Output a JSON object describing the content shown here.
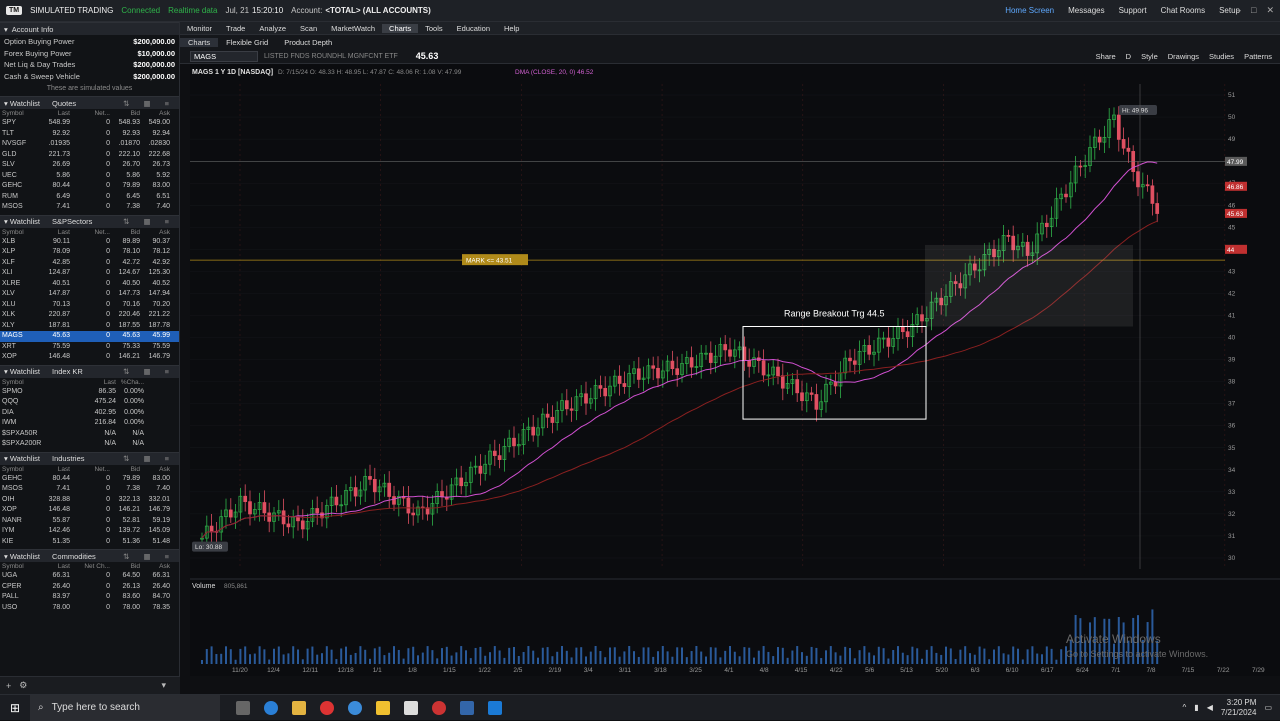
{
  "titlebar": {
    "badge": "TM",
    "app_name": "SIMULATED TRADING",
    "status": "Connected",
    "data_mode": "Realtime data",
    "date": "Jul, 21",
    "time": "15:20:10",
    "account_label": "Account:",
    "account": "<TOTAL> (ALL ACCOUNTS)",
    "home": "Home Screen",
    "messages": "Messages",
    "support": "Support",
    "chat": "Chat Rooms",
    "setup": "Setup"
  },
  "account_info": {
    "title": "Account Info",
    "rows": [
      {
        "label": "Option Buying Power",
        "value": "$200,000.00"
      },
      {
        "label": "Forex Buying Power",
        "value": "$10,000.00"
      },
      {
        "label": "Net Liq & Day Trades",
        "value": "$200,000.00"
      },
      {
        "label": "Cash & Sweep Vehicle",
        "value": "$200,000.00"
      }
    ],
    "note": "These are simulated values"
  },
  "watchlists": [
    {
      "label": "Watchlist",
      "name": "Quotes",
      "cols": [
        "Symbol",
        "Last",
        "Net...",
        "Bid",
        "Ask"
      ],
      "rows": [
        [
          "SPY",
          "548.99",
          "0",
          "548.93",
          "549.00"
        ],
        [
          "TLT",
          "92.92",
          "0",
          "92.93",
          "92.94"
        ],
        [
          "NVSGF",
          ".01935",
          "0",
          ".01870",
          ".02830"
        ],
        [
          "GLD",
          "221.73",
          "0",
          "222.10",
          "222.68"
        ],
        [
          "SLV",
          "26.69",
          "0",
          "26.70",
          "26.73"
        ],
        [
          "UEC",
          "5.86",
          "0",
          "5.86",
          "5.92"
        ],
        [
          "GEHC",
          "80.44",
          "0",
          "79.89",
          "83.00"
        ],
        [
          "RUM",
          "6.49",
          "0",
          "6.45",
          "6.51"
        ],
        [
          "MSOS",
          "7.41",
          "0",
          "7.38",
          "7.40"
        ]
      ]
    },
    {
      "label": "Watchlist",
      "name": "S&PSectors",
      "cols": [
        "Symbol",
        "Last",
        "Net...",
        "Bid",
        "Ask"
      ],
      "rows": [
        [
          "XLB",
          "90.11",
          "0",
          "89.89",
          "90.37"
        ],
        [
          "XLP",
          "78.09",
          "0",
          "78.10",
          "78.12"
        ],
        [
          "XLF",
          "42.85",
          "0",
          "42.72",
          "42.92"
        ],
        [
          "XLI",
          "124.87",
          "0",
          "124.67",
          "125.30"
        ],
        [
          "XLRE",
          "40.51",
          "0",
          "40.50",
          "40.52"
        ],
        [
          "XLV",
          "147.87",
          "0",
          "147.73",
          "147.94"
        ],
        [
          "XLU",
          "70.13",
          "0",
          "70.16",
          "70.20"
        ],
        [
          "XLK",
          "220.87",
          "0",
          "220.46",
          "221.22"
        ],
        [
          "XLY",
          "187.81",
          "0",
          "187.55",
          "187.78"
        ],
        [
          "MAGS",
          "45.63",
          "0",
          "45.63",
          "45.99"
        ],
        [
          "XRT",
          "75.59",
          "0",
          "75.33",
          "75.59"
        ],
        [
          "XOP",
          "146.48",
          "0",
          "146.21",
          "146.79"
        ]
      ]
    },
    {
      "label": "Watchlist",
      "name": "Index KR",
      "cols": [
        "Symbol",
        "Last",
        "%Cha..."
      ],
      "rows": [
        [
          "SPMO",
          "86.35",
          "0.00%"
        ],
        [
          "QQQ",
          "475.24",
          "0.00%"
        ],
        [
          "DIA",
          "402.95",
          "0.00%"
        ],
        [
          "IWM",
          "216.84",
          "0.00%"
        ],
        [
          "$SPXA50R",
          "N/A",
          "N/A"
        ],
        [
          "$SPXA200R",
          "N/A",
          "N/A"
        ]
      ]
    },
    {
      "label": "Watchlist",
      "name": "Industries",
      "cols": [
        "Symbol",
        "Last",
        "Net...",
        "Bid",
        "Ask"
      ],
      "rows": [
        [
          "GEHC",
          "80.44",
          "0",
          "79.89",
          "83.00"
        ],
        [
          "MSOS",
          "7.41",
          "0",
          "7.38",
          "7.40"
        ],
        [
          "OIH",
          "328.88",
          "0",
          "322.13",
          "332.01"
        ],
        [
          "XOP",
          "146.48",
          "0",
          "146.21",
          "146.79"
        ],
        [
          "NANR",
          "55.87",
          "0",
          "52.81",
          "59.19"
        ],
        [
          "IYM",
          "142.46",
          "0",
          "139.72",
          "145.09"
        ],
        [
          "KIE",
          "51.35",
          "0",
          "51.36",
          "51.48"
        ]
      ]
    },
    {
      "label": "Watchlist",
      "name": "Commodities",
      "cols": [
        "Symbol",
        "Last",
        "Net Ch...",
        "Bid",
        "Ask"
      ],
      "rows": [
        [
          "UGA",
          "66.31",
          "0",
          "64.50",
          "66.31"
        ],
        [
          "CPER",
          "26.40",
          "0",
          "26.13",
          "26.40"
        ],
        [
          "PALL",
          "83.97",
          "0",
          "83.60",
          "84.70"
        ],
        [
          "USO",
          "78.00",
          "0",
          "78.00",
          "78.35"
        ]
      ]
    }
  ],
  "menu": [
    "Monitor",
    "Trade",
    "Analyze",
    "Scan",
    "MarketWatch",
    "Charts",
    "Tools",
    "Education",
    "Help"
  ],
  "subtabs": [
    "Charts",
    "Flexible Grid",
    "Product Depth"
  ],
  "symbol": {
    "ticker": "MAGS",
    "price": "45.63",
    "desc": "LISTED FNDS ROUNDHL MGNFCNT ETF"
  },
  "chart_tools": [
    "Share",
    "D",
    "Style",
    "Drawings",
    "Studies",
    "Patterns"
  ],
  "chart_data": {
    "type": "candlestick",
    "title": "MAGS 1 Y 1D [NASDAQ]",
    "header": "D: 7/15/24  O: 48.33  H: 48.95  L: 47.87  C: 48.06  R: 1.08  V: 47.99",
    "studies": "DMA (CLOSE, 20, 0)  46.52",
    "ylim": [
      29.5,
      51.5
    ],
    "yticks": [
      30,
      31,
      32,
      33,
      34,
      35,
      36,
      37,
      38,
      39,
      40,
      41,
      42,
      43,
      44,
      45,
      46,
      47,
      48,
      49,
      50,
      51
    ],
    "xticks": [
      "11/20",
      "12/4",
      "12/11",
      "12/18",
      "1/1",
      "1/8",
      "1/15",
      "1/22",
      "2/5",
      "2/19",
      "3/4",
      "3/11",
      "3/18",
      "3/25",
      "4/1",
      "4/8",
      "4/15",
      "4/22",
      "5/6",
      "5/13",
      "5/20",
      "6/3",
      "6/10",
      "6/17",
      "6/24",
      "7/1",
      "7/8",
      "7/15",
      "7/22",
      "7/29"
    ],
    "hi_label": "Hi: 49.96",
    "lo_label": "Lo: 30.88",
    "mark_label": "MARK <= 43.51",
    "annotation": "Range Breakout Trg 44.5",
    "price_tags": [
      "47.99",
      "46.86",
      "45.63",
      "44"
    ],
    "volume_label": "Volume",
    "volume_value": "805,861"
  },
  "watermark": {
    "line1": "Activate Windows",
    "line2": "Go to Settings to activate Windows."
  },
  "taskbar": {
    "search": "Type here to search",
    "time": "3:20 PM",
    "date": "7/21/2024",
    "drawing": "Drawing set: Default"
  }
}
